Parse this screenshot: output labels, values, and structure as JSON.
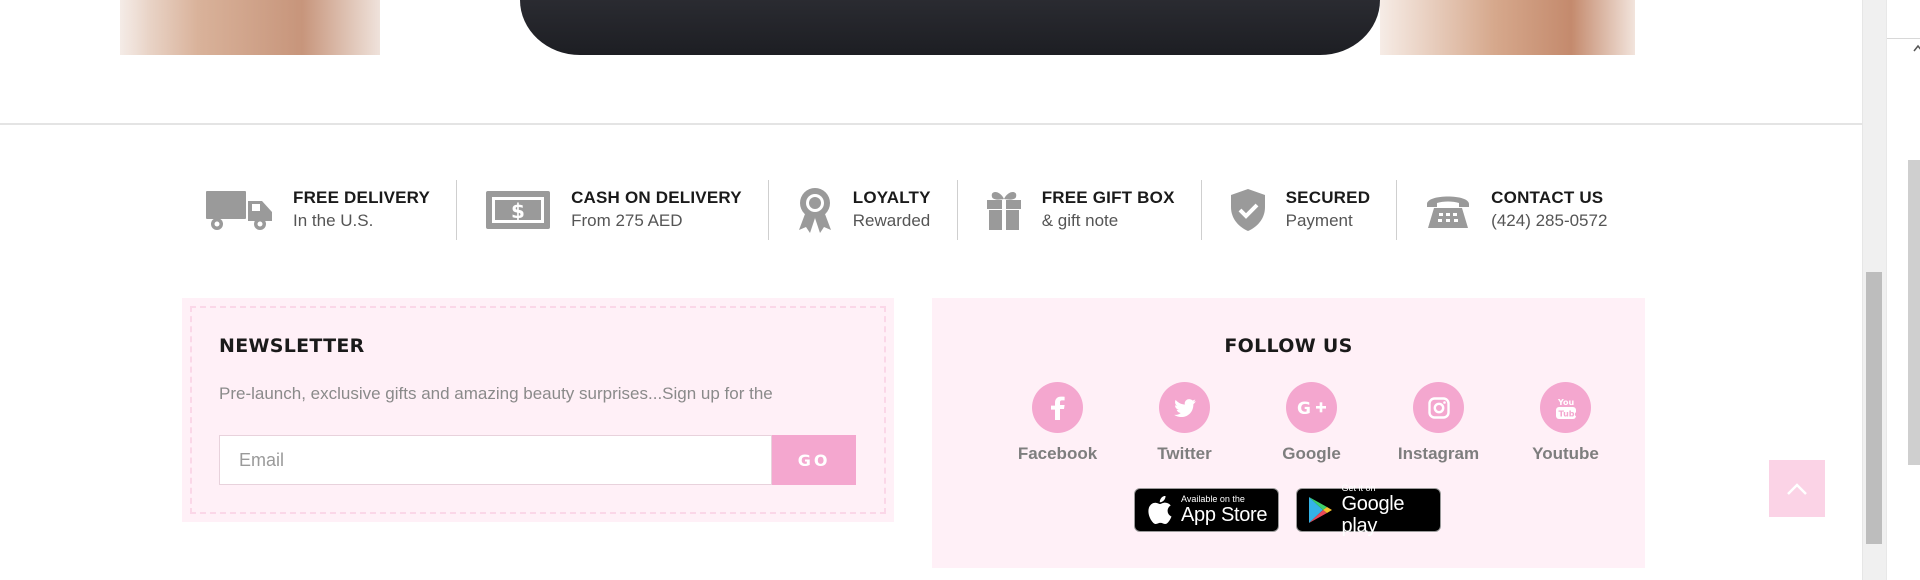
{
  "features": [
    {
      "icon": "truck-icon",
      "title": "FREE DELIVERY",
      "subtitle": "In the U.S."
    },
    {
      "icon": "cash-icon",
      "title": "CASH ON DELIVERY",
      "subtitle": "From 275 AED"
    },
    {
      "icon": "award-icon",
      "title": "LOYALTY",
      "subtitle": "Rewarded"
    },
    {
      "icon": "gift-icon",
      "title": "FREE GIFT BOX",
      "subtitle": "& gift note"
    },
    {
      "icon": "shield-icon",
      "title": "SECURED",
      "subtitle": "Payment"
    },
    {
      "icon": "phone-icon",
      "title": "CONTACT US",
      "subtitle": "(424) 285-0572"
    }
  ],
  "newsletter": {
    "title": "NEWSLETTER",
    "description": "Pre-launch, exclusive gifts and amazing beauty surprises...Sign up for the",
    "email_placeholder": "Email",
    "submit_label": "GO"
  },
  "follow": {
    "title": "FOLLOW US",
    "socials": [
      {
        "icon": "facebook-icon",
        "label": "Facebook"
      },
      {
        "icon": "twitter-icon",
        "label": "Twitter"
      },
      {
        "icon": "google-plus-icon",
        "label": "Google"
      },
      {
        "icon": "instagram-icon",
        "label": "Instagram"
      },
      {
        "icon": "youtube-icon",
        "label": "Youtube"
      }
    ],
    "stores": {
      "appstore_small": "Available on the",
      "appstore_big": "App Store",
      "googleplay_small": "Get it on",
      "googleplay_big": "Google play"
    }
  },
  "colors": {
    "accent_pink": "#f4a7cf",
    "panel_bg": "#fff0f7",
    "icon_gray": "#9a9a9a"
  }
}
